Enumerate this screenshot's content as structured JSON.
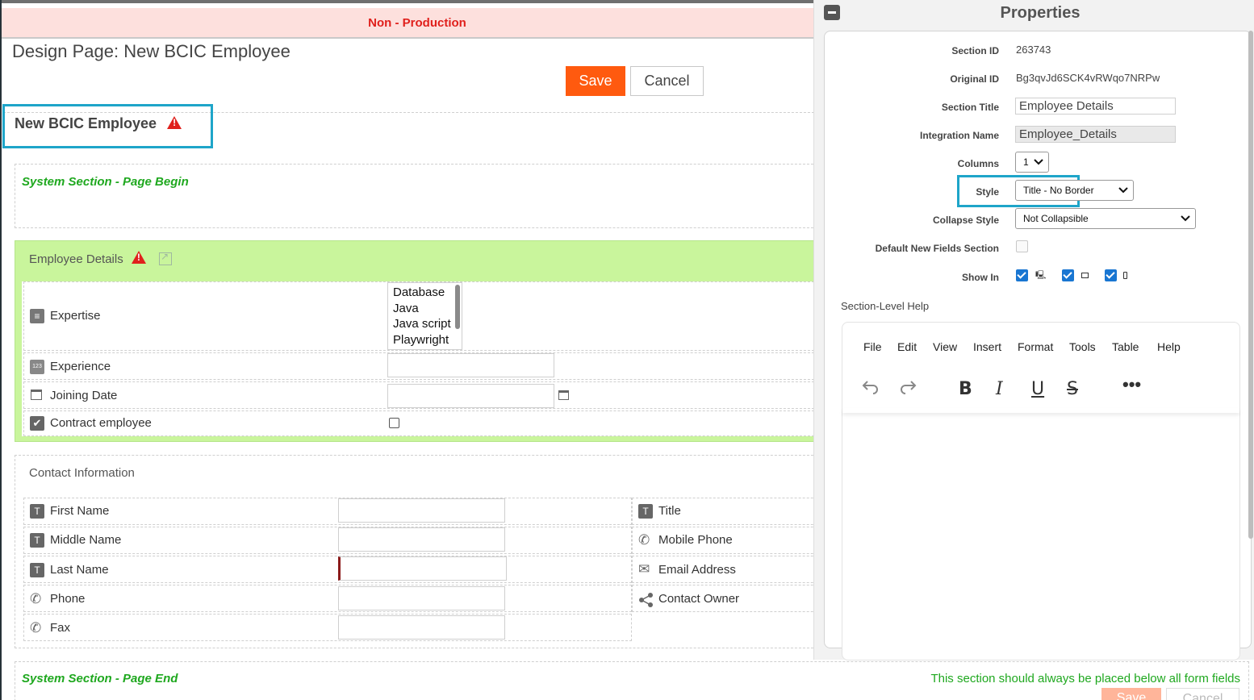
{
  "banner": {
    "text": "Non - Production"
  },
  "design": {
    "title": "Design Page: New BCIC Employee",
    "save_label": "Save",
    "cancel_label": "Cancel"
  },
  "page_name": "New BCIC Employee",
  "sections": {
    "begin": "System Section - Page Begin",
    "end": "System Section - Page End",
    "end_note": "This section should always be placed below all form fields",
    "end_save": "Save",
    "end_cancel": "Cancel"
  },
  "employee": {
    "title": "Employee Details",
    "fields": {
      "expertise": "Expertise",
      "experience": "Experience",
      "joining_date": "Joining Date",
      "contract": "Contract employee"
    },
    "expertise_options": [
      "Database",
      "Java",
      "Java script",
      "Playwright"
    ]
  },
  "contact": {
    "title": "Contact Information",
    "left": [
      "First Name",
      "Middle Name",
      "Last Name",
      "Phone",
      "Fax"
    ],
    "right": [
      "Title",
      "Mobile Phone",
      "Email Address",
      "Contact Owner"
    ]
  },
  "props": {
    "title": "Properties",
    "labels": {
      "section_id": "Section ID",
      "original_id": "Original ID",
      "section_title": "Section Title",
      "integration_name": "Integration Name",
      "columns": "Columns",
      "style": "Style",
      "collapse_style": "Collapse Style",
      "default_new": "Default New Fields Section",
      "show_in": "Show In"
    },
    "values": {
      "section_id": "263743",
      "original_id": "Bg3qvJd6SCK4vRWqo7NRPw",
      "section_title": "Employee Details",
      "integration_name": "Employee_Details",
      "columns": "1",
      "style": "Title - No Border",
      "collapse_style": "Not Collapsible"
    },
    "help_label": "Section-Level Help",
    "editor_menu": [
      "File",
      "Edit",
      "View",
      "Insert",
      "Format",
      "Tools",
      "Table",
      "Help"
    ]
  },
  "colors": {
    "accent": "#ff5a0f",
    "highlight": "#1ea5c9",
    "section_green": "#c9f59c",
    "system_green": "#1fa81f"
  }
}
